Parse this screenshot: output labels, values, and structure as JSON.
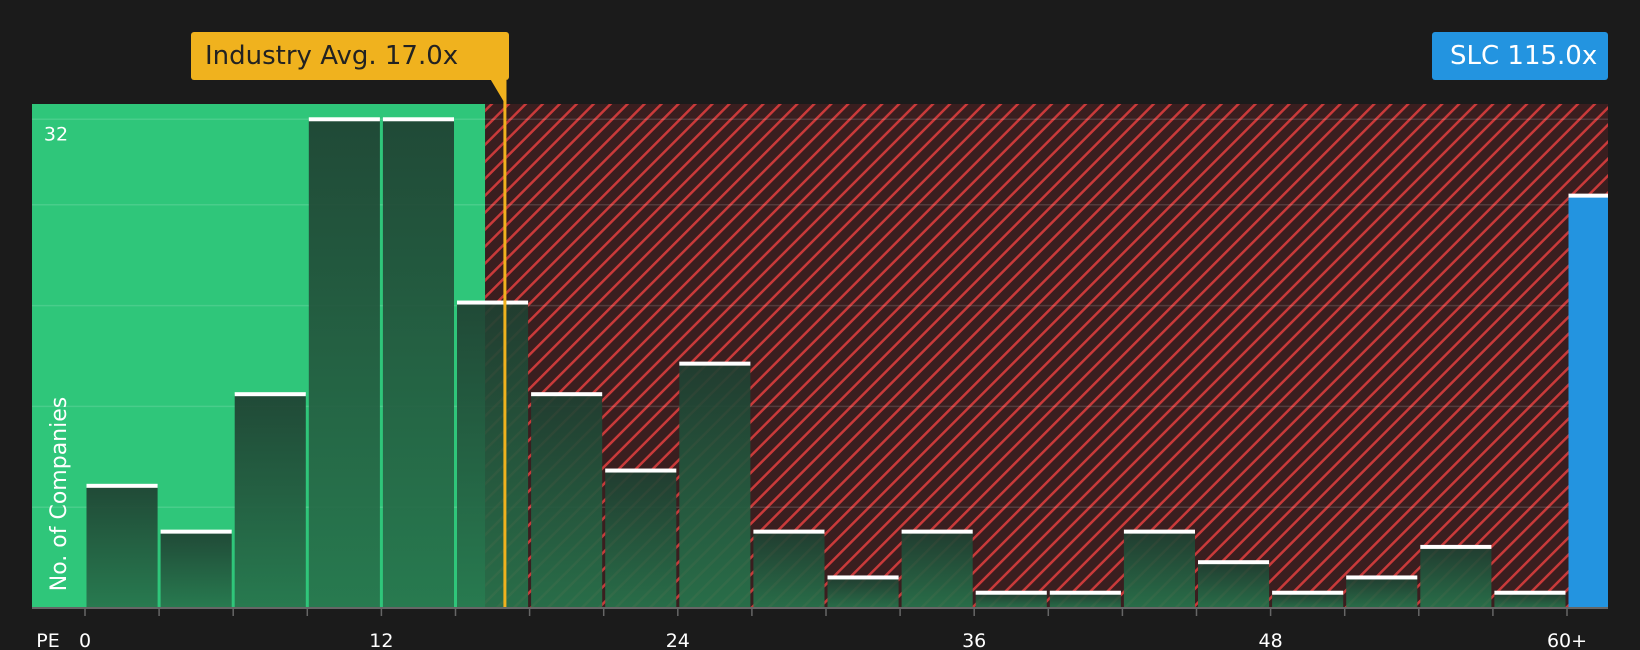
{
  "chart_data": {
    "type": "bar",
    "title": "",
    "xlabel": "PE",
    "ylabel": "No. of Companies",
    "x_tick_labels": [
      "0",
      "12",
      "24",
      "36",
      "48",
      "60+"
    ],
    "y_tick_labels": [
      "32"
    ],
    "bin_width": 3,
    "xlim": [
      0,
      61.5
    ],
    "ylim": [
      0,
      33
    ],
    "categories": [
      "0-3",
      "3-6",
      "6-9",
      "9-12",
      "12-15",
      "15-18",
      "18-21",
      "21-24",
      "24-27",
      "27-30",
      "30-33",
      "33-36",
      "36-39",
      "39-42",
      "42-45",
      "45-48",
      "48-51",
      "51-54",
      "54-57",
      "57-60"
    ],
    "values": [
      8,
      5,
      14,
      32,
      32,
      20,
      14,
      9,
      16,
      5,
      2,
      5,
      1,
      1,
      5,
      3,
      1,
      2,
      4,
      1
    ],
    "company": {
      "label": "SLC 115.0x",
      "value": 27
    },
    "industry_average": {
      "label": "Industry Avg. 17.0x",
      "value": 17.0
    },
    "fair_zone_max": 16.2,
    "grid": true,
    "colors": {
      "background": "#1b1b1b",
      "fair_zone": "#2fc67a",
      "overvalued_zone": "#c93a3a",
      "industry_avg": "#f0b21e",
      "company": "#2394e0",
      "bar_cap": "#ffffff"
    }
  }
}
